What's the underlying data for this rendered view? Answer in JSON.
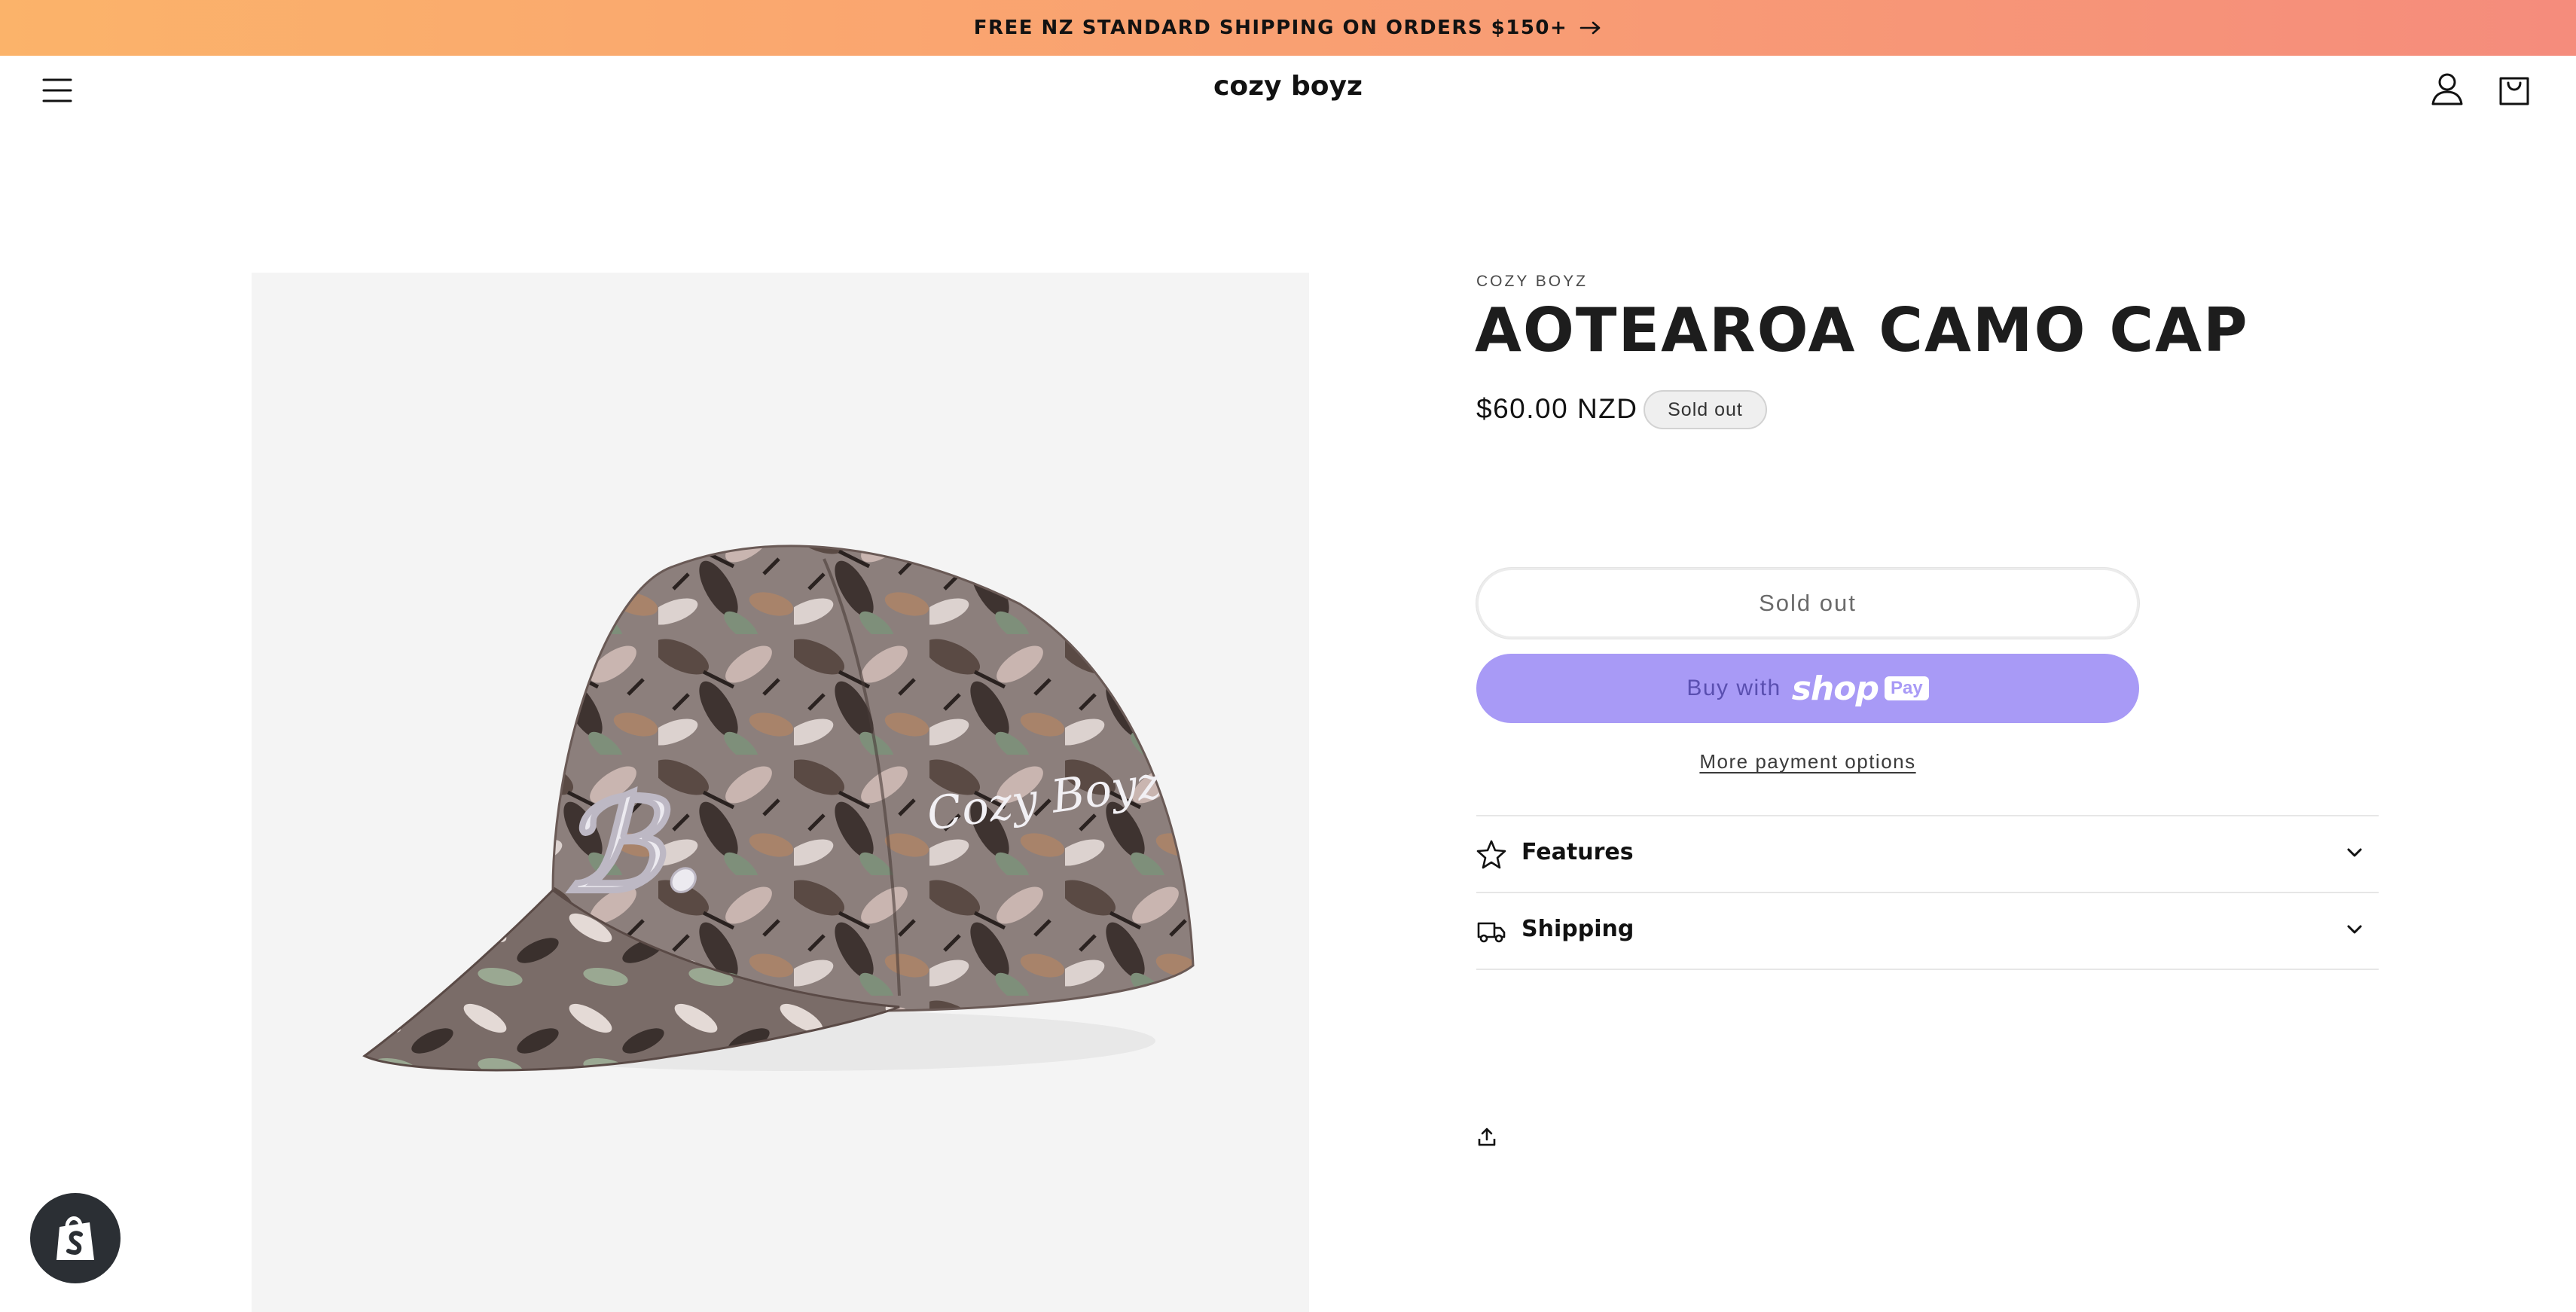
{
  "announcement": {
    "text": "FREE NZ STANDARD SHIPPING ON ORDERS $150+"
  },
  "header": {
    "logo": "cozy boyz"
  },
  "product": {
    "vendor": "COZY BOYZ",
    "title": "AOTEAROA CAMO CAP",
    "price": "$60.00 NZD",
    "badge": "Sold out",
    "cap_script": "Cozy Boyz",
    "cap_monogram": "B."
  },
  "buttons": {
    "sold_out": "Sold out",
    "buy_with": "Buy with",
    "shop": "shop",
    "pay": "Pay",
    "more_payment": "More payment options"
  },
  "accordions": [
    {
      "label": "Features",
      "icon": "star-icon"
    },
    {
      "label": "Shipping",
      "icon": "truck-icon"
    }
  ],
  "colors": {
    "announce_start": "#fbb36a",
    "announce_end": "#f58c7c",
    "shop_pay": "#a89af6",
    "badge_bg": "#efefef"
  }
}
